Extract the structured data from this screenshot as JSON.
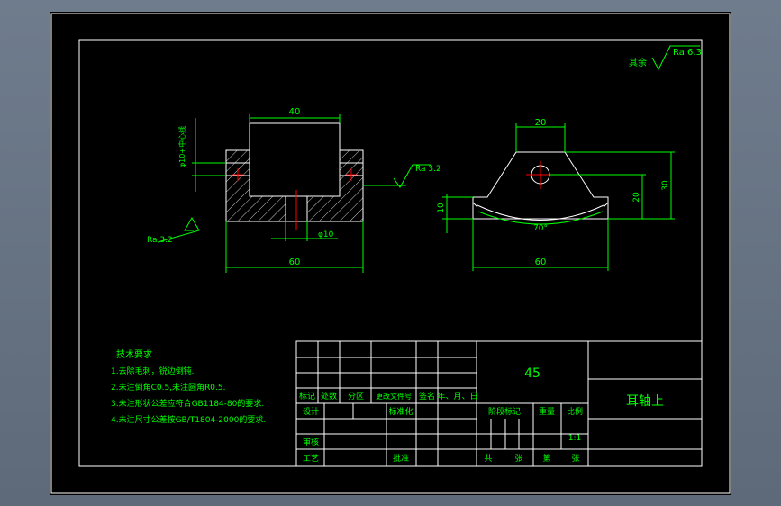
{
  "colors": {
    "background": "#000000",
    "frame": "#ffffff",
    "part": "#ffffff",
    "dimension": "#00ff00",
    "table_text": "#00ff00",
    "centerline": "#ff0000",
    "title_text": "#00ff00"
  },
  "roughness": {
    "general_prefix": "其余",
    "general_value": "Ra 6.3",
    "front_bottom": "Ra 3.2",
    "front_right": "Ra 3.2"
  },
  "dimensions": {
    "front_top_width": "40",
    "front_total_width": "60",
    "front_hole_dia": "φ10",
    "front_side_label": "φ10+中心线",
    "side_top_width": "20",
    "side_total_width": "60",
    "side_height_total": "30",
    "side_height_hole": "20",
    "side_base_height": "10",
    "side_angle": "70°"
  },
  "tech": {
    "title": "技术要求",
    "lines": [
      "1.去除毛刺，锐边倒钝.",
      "2.未注倒角C0.5,未注圆角R0.5.",
      "3.未注形状公差应符合GB1184-80的要求.",
      "4.未注尺寸公差按GB/T1804-2000的要求."
    ]
  },
  "title_block": {
    "material": "45",
    "part_name": "耳轴上",
    "revision_headers": [
      "标记",
      "处数",
      "分区",
      "更改文件号",
      "签名",
      "年、月、日"
    ],
    "roles": {
      "design": "设计",
      "standardize": "标准化",
      "review": "审核",
      "process": "工艺",
      "approve": "批准"
    },
    "stage_label": "阶段标记",
    "weight_label": "重量",
    "scale_label": "比例",
    "scale_value": "1:1",
    "sheets_total": "共",
    "sheets_unit": "张",
    "sheet_no": "第",
    "sheet_unit": "张"
  }
}
